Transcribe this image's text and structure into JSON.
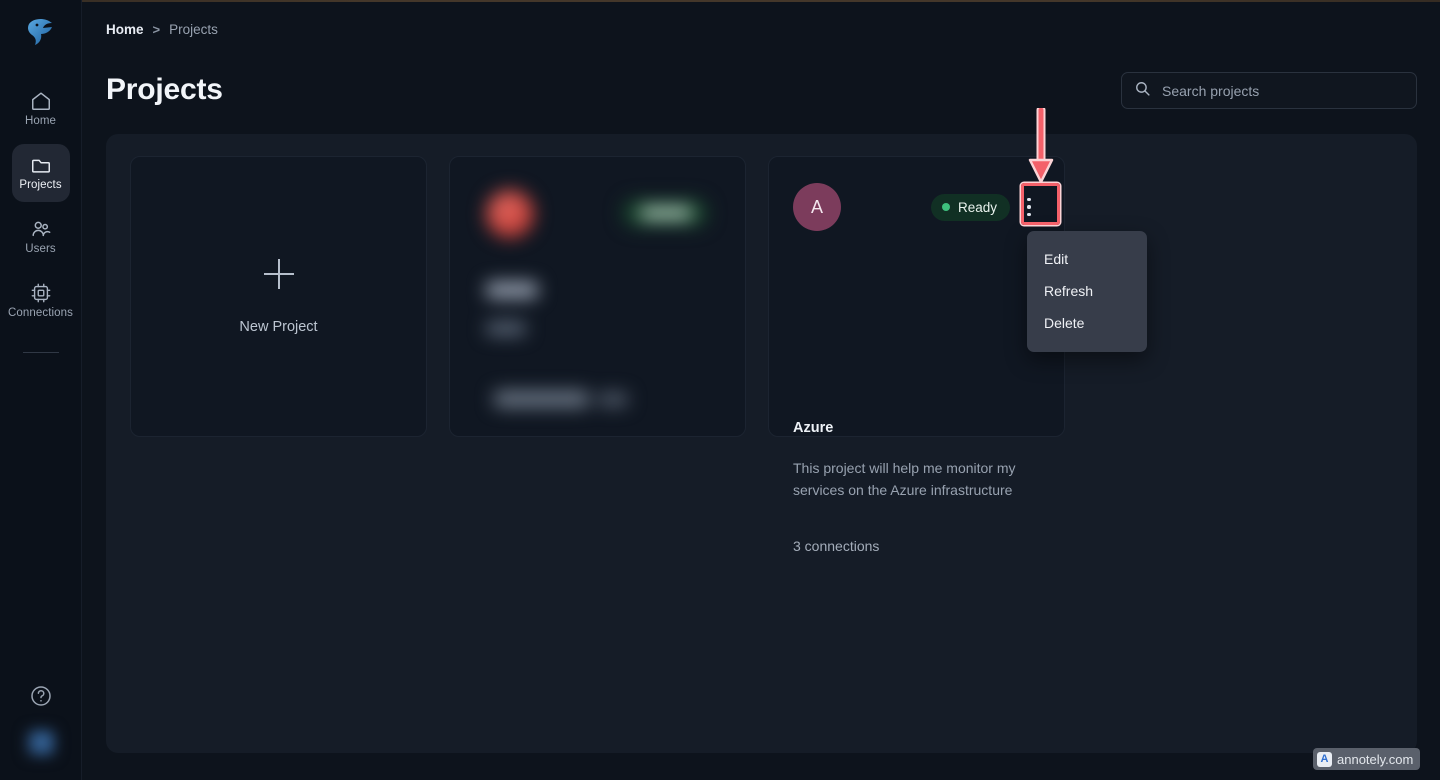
{
  "app": {
    "logo_icon": "falcon-logo-icon",
    "background": "#0d131c",
    "panel_background": "#151c27"
  },
  "sidebar": {
    "items": [
      {
        "label": "Home",
        "icon": "home-icon",
        "active": false
      },
      {
        "label": "Projects",
        "icon": "folder-icon",
        "active": true
      },
      {
        "label": "Users",
        "icon": "users-icon",
        "active": false
      },
      {
        "label": "Connections",
        "icon": "chip-icon",
        "active": false
      }
    ],
    "help_icon": "help-circle-icon",
    "avatar_icon": "user-avatar"
  },
  "breadcrumb": {
    "home": "Home",
    "separator": ">",
    "current": "Projects"
  },
  "header": {
    "title": "Projects"
  },
  "search": {
    "icon": "search-icon",
    "placeholder": "Search projects",
    "value": ""
  },
  "cards": {
    "new_project": {
      "icon": "plus-icon",
      "label": "New Project"
    },
    "redacted_project": {
      "blurred": true,
      "avatar_color": "#c8433c",
      "badge_color": "#16402a"
    },
    "azure_project": {
      "avatar_initial": "A",
      "avatar_color": "#7c3c5c",
      "status": "Ready",
      "status_dot_color": "#3ec07d",
      "status_badge_color": "#113024",
      "name": "Azure",
      "description": "This project will help me monitor my services on the Azure infrastructure",
      "connections": "3 connections",
      "menu_icon": "kebab-menu-icon"
    }
  },
  "dropdown": {
    "items": [
      {
        "label": "Edit"
      },
      {
        "label": "Refresh"
      },
      {
        "label": "Delete"
      }
    ]
  },
  "annotation": {
    "arrow_icon": "down-arrow-annotation",
    "highlight_icon": "highlight-box-annotation",
    "color": "#f4616a"
  },
  "watermark": {
    "logo": "A",
    "text": "annotely.com"
  }
}
